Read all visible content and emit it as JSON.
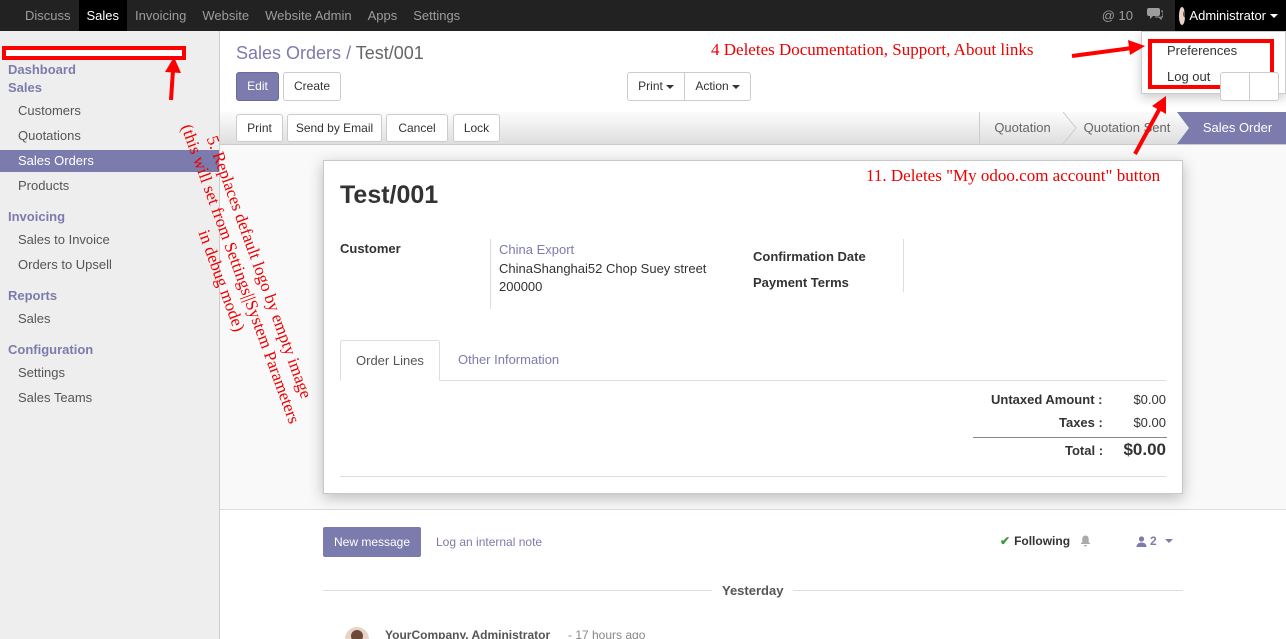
{
  "topbar": {
    "menus": [
      "Discuss",
      "Sales",
      "Invoicing",
      "Website",
      "Website Admin",
      "Apps",
      "Settings"
    ],
    "active_menu": "Sales",
    "mentions": "@ 10",
    "user": "Administrator"
  },
  "user_menu": {
    "items": [
      "Preferences",
      "Log out"
    ]
  },
  "sidebar": {
    "sections": [
      {
        "label": "Dashboard"
      },
      {
        "label": "Sales",
        "items": [
          "Customers",
          "Quotations",
          "Sales Orders",
          "Products"
        ]
      },
      {
        "label": "Invoicing",
        "items": [
          "Sales to Invoice",
          "Orders to Upsell"
        ]
      },
      {
        "label": "Reports",
        "items": [
          "Sales"
        ]
      },
      {
        "label": "Configuration",
        "items": [
          "Settings",
          "Sales Teams"
        ]
      }
    ],
    "active_item": "Sales Orders"
  },
  "breadcrumb": {
    "parent": "Sales Orders",
    "separator": "/",
    "current": "Test/001"
  },
  "control": {
    "edit": "Edit",
    "create": "Create",
    "print": "Print",
    "action": "Action"
  },
  "statusbar": {
    "buttons": [
      "Print",
      "Send by Email",
      "Cancel",
      "Lock"
    ],
    "stages": [
      "Quotation",
      "Quotation Sent",
      "Sales Order"
    ],
    "active_stage": "Sales Order"
  },
  "form": {
    "title": "Test/001",
    "customer_label": "Customer",
    "customer_name": "China Export",
    "customer_address": "ChinaShanghai52 Chop Suey street",
    "customer_zip": "200000",
    "confirmation_date_label": "Confirmation Date",
    "payment_terms_label": "Payment Terms",
    "tabs": [
      "Order Lines",
      "Other Information"
    ],
    "untaxed_label": "Untaxed Amount :",
    "untaxed_value": "$0.00",
    "taxes_label": "Taxes :",
    "taxes_value": "$0.00",
    "total_label": "Total :",
    "total_value": "$0.00"
  },
  "chatter": {
    "new_message": "New message",
    "log_note": "Log an internal note",
    "following": "Following",
    "followers": "2",
    "date_separator": "Yesterday",
    "author": "YourCompany, Administrator",
    "time": "- 17 hours ago"
  },
  "annotations": {
    "a4": "4 Deletes Documentation, Support, About links",
    "a11": "11. Deletes \"My odoo.com account\" button",
    "a5_line1": "5. Replaces default logo by empty image",
    "a5_line2": "(this will set from Settings||System Parameters",
    "a5_line3": "in debug mode)"
  },
  "colors": {
    "brand": "#7c7bad",
    "annotation": "#ee0000"
  }
}
